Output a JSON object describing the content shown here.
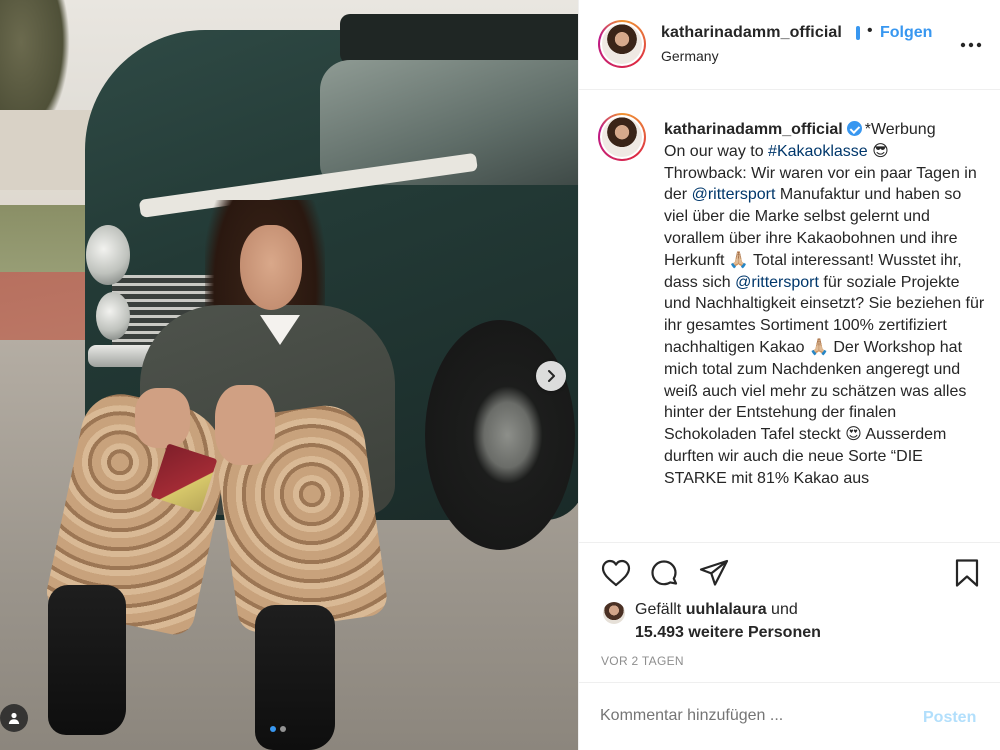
{
  "photo": {
    "next_icon": "chevron-right-icon",
    "tags_icon": "user-tag-icon",
    "carousel_dots": 2,
    "active_dot": 0
  },
  "header": {
    "username": "katharinadamm_official",
    "separator": "•",
    "follow_label": "Folgen",
    "location": "Germany",
    "more_icon": "more-horizontal-icon"
  },
  "caption": {
    "username": "katharinadamm_official",
    "segments": [
      {
        "text": "*Werbung\nOn our way to ",
        "type": "text"
      },
      {
        "text": "#Kakaoklasse",
        "type": "link"
      },
      {
        "text": " 😎\nThrowback: Wir waren vor ein paar Tagen in der ",
        "type": "text"
      },
      {
        "text": "@rittersport",
        "type": "link"
      },
      {
        "text": " Manufaktur und haben so viel über die Marke selbst gelernt und vorallem über ihre Kakaobohnen und ihre Herkunft 🙏🏼 Total interessant! Wusstet ihr, dass sich ",
        "type": "text"
      },
      {
        "text": "@rittersport",
        "type": "link"
      },
      {
        "text": " für soziale Projekte und Nachhaltigkeit einsetzt? Sie beziehen für ihr gesamtes Sortiment 100% zertifiziert nachhaltigen Kakao 🙏🏼 Der Workshop hat mich total zum Nachdenken angeregt und weiß auch viel mehr zu schätzen was alles hinter der Entstehung der finalen Schokoladen Tafel steckt 😍 Ausserdem durften wir auch die neue Sorte “DIE STARKE mit 81% Kakao aus",
        "type": "text"
      }
    ]
  },
  "actions": {
    "like_icon": "heart-icon",
    "comment_icon": "comment-icon",
    "share_icon": "share-icon",
    "save_icon": "bookmark-icon"
  },
  "likes": {
    "prefix": "Gefällt ",
    "user": "uuhlalaura",
    "suffix": " und",
    "count_text": "15.493 weitere Personen"
  },
  "timestamp": "VOR 2 TAGEN",
  "comment": {
    "placeholder": "Kommentar hinzufügen ...",
    "post_label": "Posten"
  },
  "colors": {
    "accent": "#3897f0",
    "text": "#262626",
    "secondary": "#8e8e8e",
    "link": "#00376b",
    "post_disabled": "#b2dffc",
    "border": "#efefef"
  }
}
